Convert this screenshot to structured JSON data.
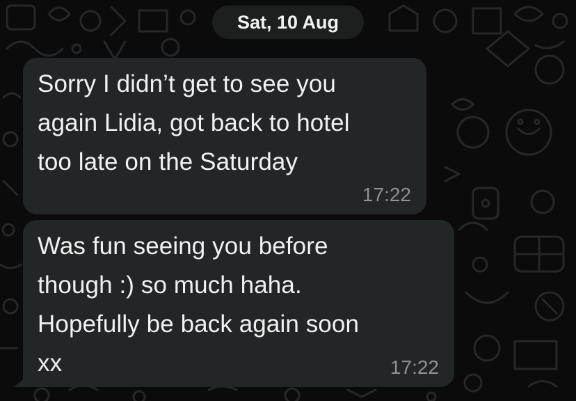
{
  "chat": {
    "date_separator": "Sat, 10 Aug",
    "messages": [
      {
        "direction": "incoming",
        "text": "Sorry I didn’t get to see you\nagain Lidia, got back to hotel\ntoo late on the Saturday",
        "time": "17:22"
      },
      {
        "direction": "incoming",
        "text": "Was fun seeing you before\nthough :) so much haha.\nHopefully be back again soon\nxx",
        "time": "17:22"
      }
    ]
  },
  "theme": {
    "background": "#0b0b0b",
    "bubble_incoming": "#232626",
    "text_color": "#f1f1f1",
    "timestamp_color": "#8e9292",
    "date_pill_background": "#1d1f1f"
  },
  "icons": [
    "chat-wallpaper-doodle-pattern"
  ]
}
